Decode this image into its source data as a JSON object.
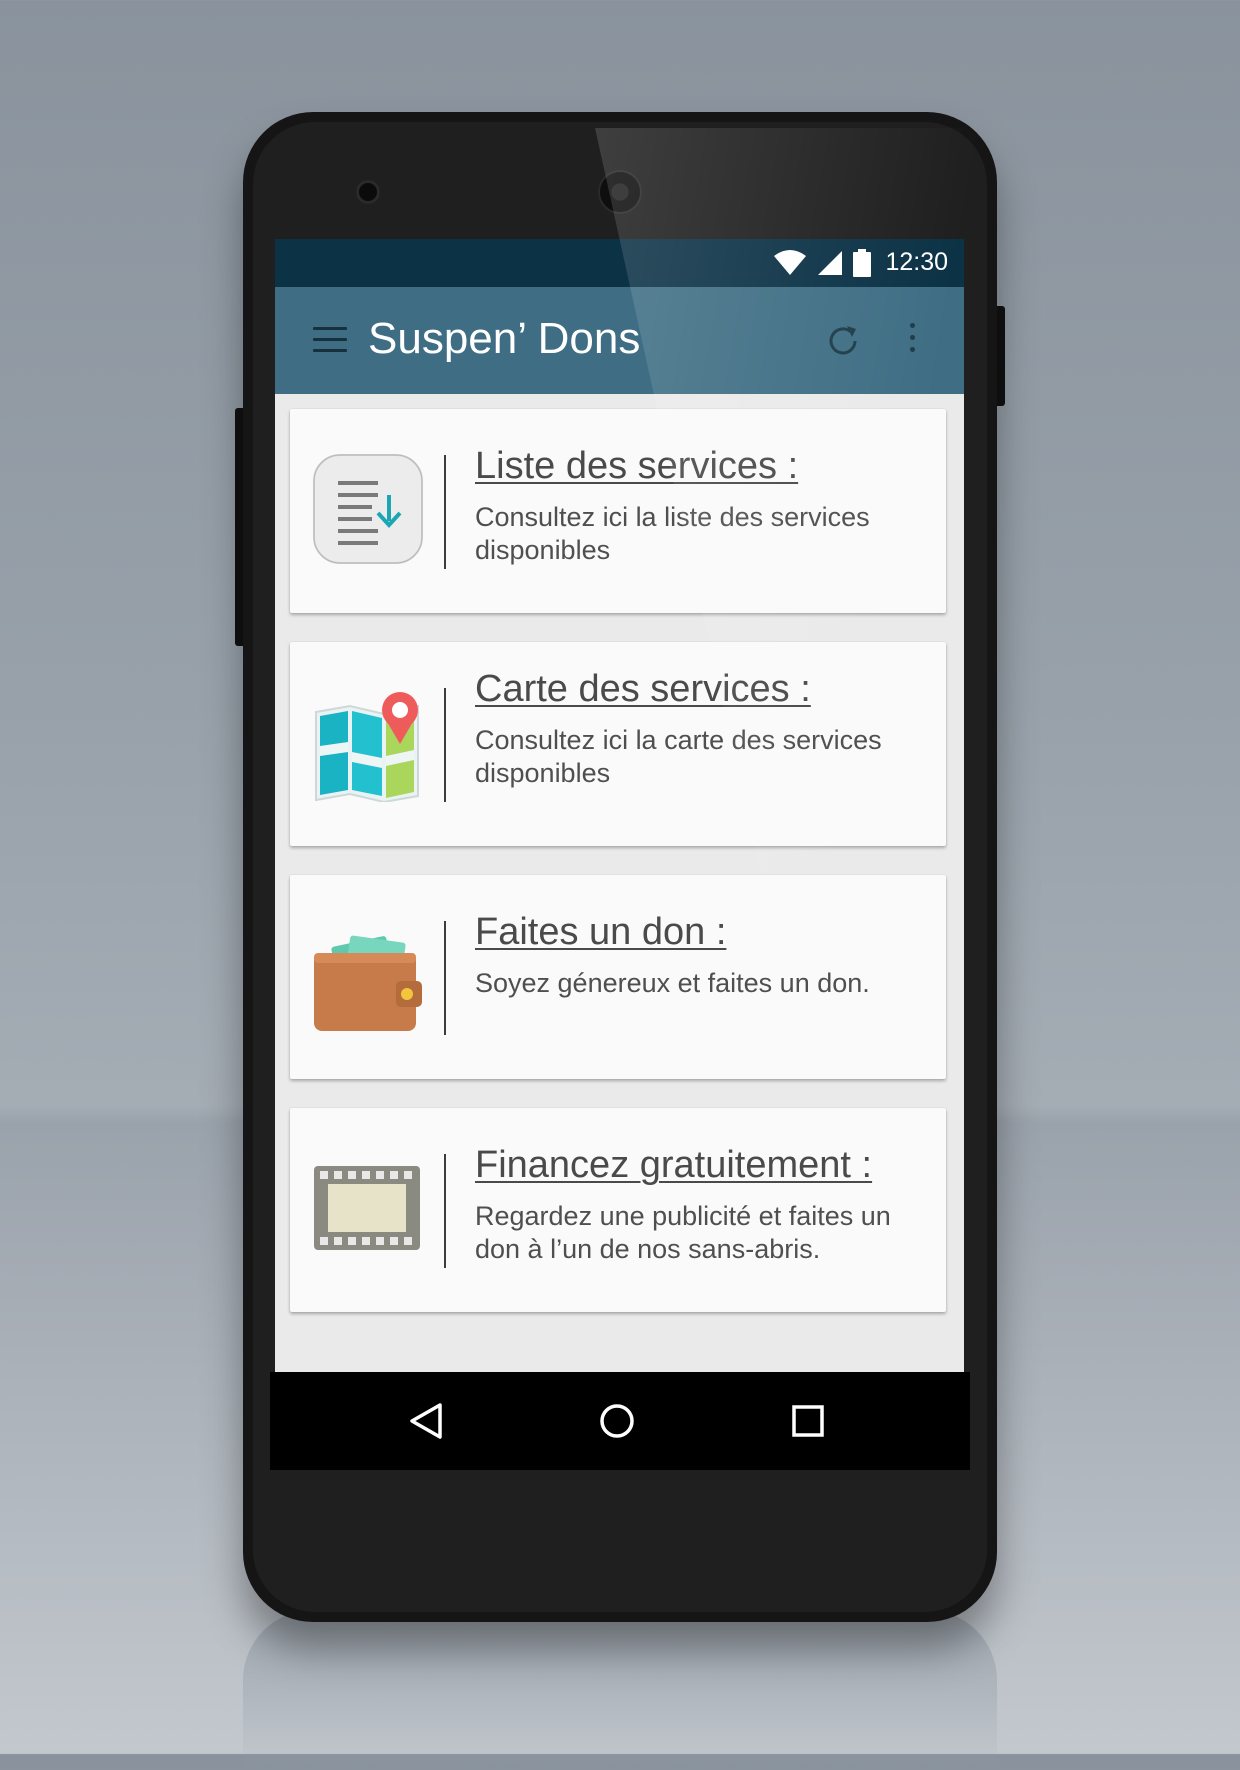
{
  "status_bar": {
    "time": "12:30",
    "icons": [
      "wifi-icon",
      "signal-icon",
      "battery-icon"
    ]
  },
  "app_bar": {
    "title": "Suspen’ Dons",
    "icons": [
      "menu-icon",
      "refresh-icon",
      "more-vert-icon"
    ]
  },
  "cards": [
    {
      "icon": "list-download-icon",
      "title": "Liste des services :",
      "description": "Consultez ici la liste des services disponibles"
    },
    {
      "icon": "map-pin-icon",
      "title": "Carte des services :",
      "description": "Consultez ici la carte des services disponibles"
    },
    {
      "icon": "wallet-icon",
      "title": "Faites un don :",
      "description": "Soyez génereux et faites un don."
    },
    {
      "icon": "film-strip-icon",
      "title": "Financez gratuitement :",
      "description": "Regardez une publicité et faites un don à l’un de nos sans-abris."
    }
  ],
  "nav_bar": {
    "icons": [
      "back-icon",
      "home-icon",
      "recents-icon"
    ]
  },
  "colors": {
    "status_bar": "#0c3246",
    "app_bar": "#3f6e84",
    "card_background": "#fafafa",
    "screen_background": "#eaeaea"
  }
}
